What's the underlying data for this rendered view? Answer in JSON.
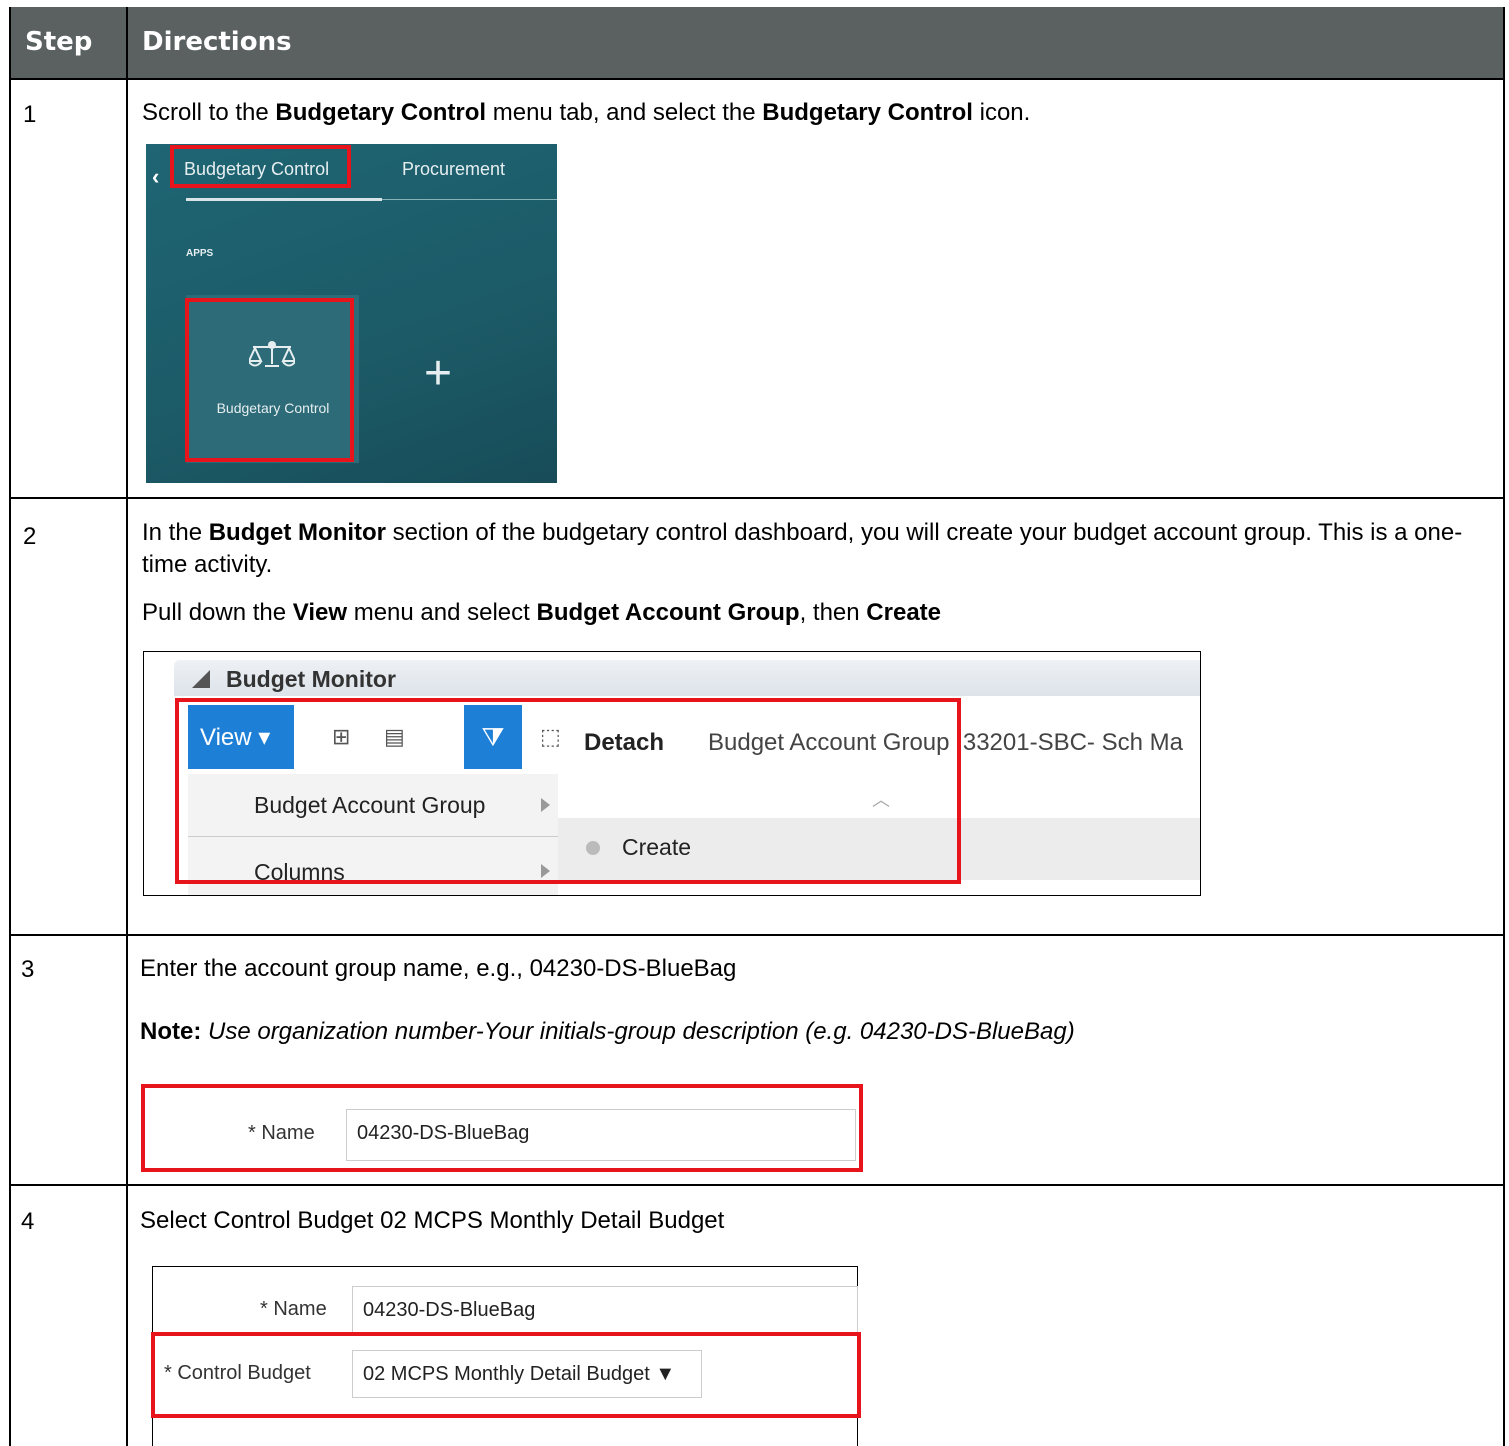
{
  "header": {
    "step": "Step",
    "directions": "Directions"
  },
  "steps": [
    {
      "number": "1",
      "text": [
        "Scroll to the ",
        "Budgetary Control",
        " menu tab, and select the ",
        "Budgetary Control",
        " icon."
      ],
      "screenshot": {
        "tab_active": "Budgetary Control",
        "tab_other": "Procurement",
        "section_label": "APPS",
        "tile_label": "Budgetary Control",
        "tile_icon": "scales-icon",
        "add_icon": "plus-icon"
      }
    },
    {
      "number": "2",
      "text": [
        "In the ",
        "Budget Monitor",
        " section of the budgetary control dashboard, you will create your budget account group. This is a one-time activity."
      ],
      "text2": [
        "Pull down the ",
        "View",
        " menu and select ",
        "Budget Account Group",
        ", then ",
        "Create"
      ],
      "screenshot": {
        "panel_title": "Budget Monitor",
        "view_label": "View ▾",
        "detach_label": "Detach",
        "group_label": "Budget Account Group",
        "group_value": "33201-SBC- Sch Ma",
        "menu_item_1": "Budget Account Group",
        "menu_item_2": "Columns",
        "submenu_item": "Create"
      }
    },
    {
      "number": "3",
      "text": "Enter the account group name, e.g., 04230-DS-BlueBag",
      "note_label": "Note:",
      "note_text": " Use organization number-Your initials-group description (e.g. 04230-DS-BlueBag)",
      "screenshot": {
        "name_label": "* Name",
        "name_value": "04230-DS-BlueBag"
      }
    },
    {
      "number": "4",
      "text": "Select Control Budget 02 MCPS Monthly Detail Budget",
      "screenshot": {
        "name_label": "* Name",
        "name_value": "04230-DS-BlueBag",
        "control_label": "* Control Budget",
        "control_value": "02 MCPS Monthly Detail Budget ▼"
      }
    }
  ]
}
